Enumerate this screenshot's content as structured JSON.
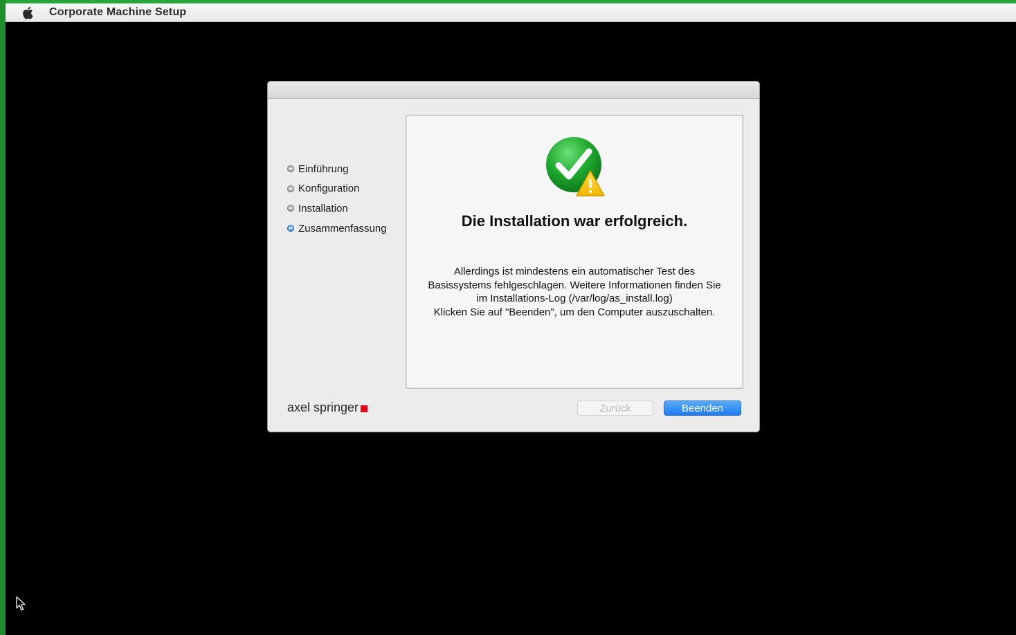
{
  "menubar": {
    "app_name": "Corporate Machine Setup",
    "icon": "apple-icon"
  },
  "steps": [
    {
      "label": "Einführung",
      "active": false
    },
    {
      "label": "Konfiguration",
      "active": false
    },
    {
      "label": "Installation",
      "active": false
    },
    {
      "label": "Zusammenfassung",
      "active": true
    }
  ],
  "content": {
    "status_icon": "success-with-warning-icon",
    "headline": "Die Installation war erfolgreich.",
    "message_lines": [
      "Allerdings ist mindestens ein automatischer Test des",
      "Basissystems fehlgeschlagen. Weitere Informationen finden Sie",
      "im Installations-Log (/var/log/as_install.log)",
      "Klicken Sie auf \"Beenden\", um den Computer auszuschalten."
    ]
  },
  "footer": {
    "brand": "axel springer",
    "back_label": "Zurück",
    "finish_label": "Beenden"
  },
  "colors": {
    "accent": "#1d7cf2",
    "brand_red": "#e3001b",
    "success_green": "#1faa2e",
    "warning_yellow": "#f6c400"
  }
}
